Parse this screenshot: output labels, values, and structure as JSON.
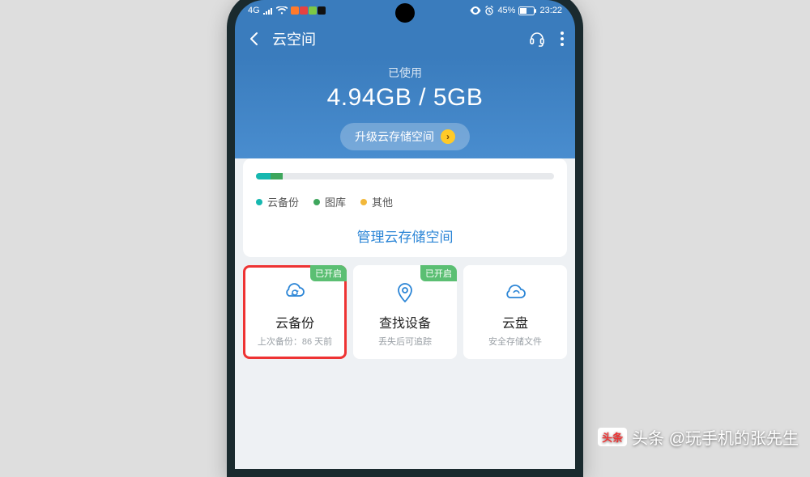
{
  "statusbar": {
    "network": "4G",
    "battery_pct": "45%",
    "time": "23:22"
  },
  "titlebar": {
    "title": "云空间"
  },
  "hero": {
    "used_label": "已使用",
    "used_amount": "4.94GB / 5GB",
    "upgrade_label": "升级云存储空间"
  },
  "storage": {
    "legend": [
      "云备份",
      "图库",
      "其他"
    ],
    "manage_label": "管理云存储空间"
  },
  "tiles": [
    {
      "badge": "已开启",
      "title": "云备份",
      "sub": "上次备份：86 天前"
    },
    {
      "badge": "已开启",
      "title": "查找设备",
      "sub": "丢失后可追踪"
    },
    {
      "badge": "",
      "title": "云盘",
      "sub": "安全存储文件"
    }
  ],
  "watermark": "头条 @玩手机的张先生"
}
